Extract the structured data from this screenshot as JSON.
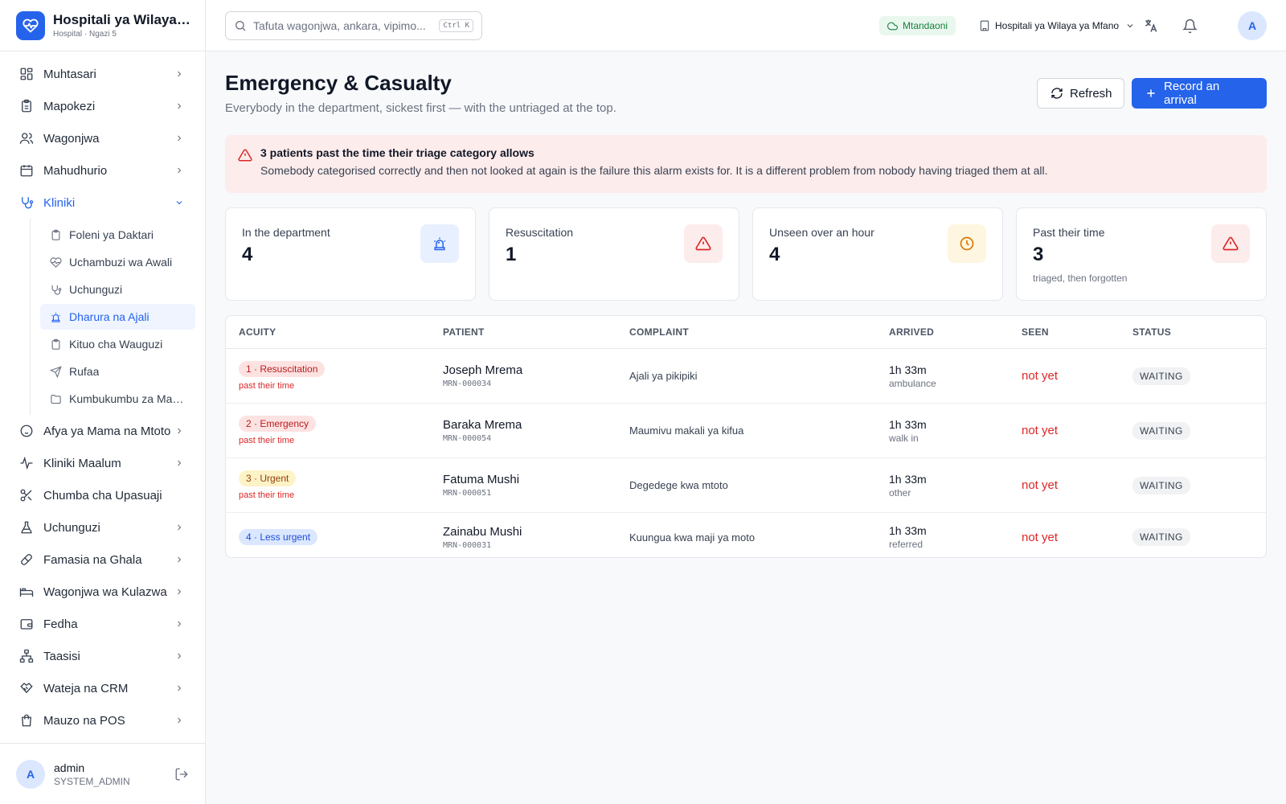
{
  "brand": {
    "name": "Hospitali ya Wilaya ya Mfano",
    "subtitle": "Hospital · Ngazi 5"
  },
  "sidebar": {
    "items": [
      {
        "label": "Muhtasari",
        "icon": "dashboard-icon"
      },
      {
        "label": "Mapokezi",
        "icon": "clipboard-icon"
      },
      {
        "label": "Wagonjwa",
        "icon": "users-icon"
      },
      {
        "label": "Mahudhurio",
        "icon": "calendar-icon"
      },
      {
        "label": "Kliniki",
        "icon": "stethoscope-icon"
      },
      {
        "label": "Afya ya Mama na Mtoto",
        "icon": "baby-icon"
      },
      {
        "label": "Kliniki Maalum",
        "icon": "pulse-icon"
      },
      {
        "label": "Chumba cha Upasuaji",
        "icon": "scissors-icon"
      },
      {
        "label": "Uchunguzi",
        "icon": "flask-icon"
      },
      {
        "label": "Famasia na Ghala",
        "icon": "pill-icon"
      },
      {
        "label": "Wagonjwa wa Kulazwa",
        "icon": "bed-icon"
      },
      {
        "label": "Fedha",
        "icon": "wallet-icon"
      },
      {
        "label": "Taasisi",
        "icon": "org-icon"
      },
      {
        "label": "Wateja na CRM",
        "icon": "handshake-icon"
      },
      {
        "label": "Mauzo na POS",
        "icon": "shopping-bag-icon"
      }
    ],
    "sub_items": [
      {
        "label": "Foleni ya Daktari",
        "icon": "clipboard-icon"
      },
      {
        "label": "Uchambuzi wa Awali",
        "icon": "heart-pulse-icon"
      },
      {
        "label": "Uchunguzi",
        "icon": "stethoscope-icon"
      },
      {
        "label": "Dharura na Ajali",
        "icon": "siren-icon"
      },
      {
        "label": "Kituo cha Wauguzi",
        "icon": "clipboard-icon"
      },
      {
        "label": "Rufaa",
        "icon": "send-icon"
      },
      {
        "label": "Kumbukumbu za Matibabu",
        "icon": "folder-icon"
      }
    ]
  },
  "user": {
    "initial": "A",
    "name": "admin",
    "role": "SYSTEM_ADMIN"
  },
  "topbar": {
    "search_placeholder": "Tafuta wagonjwa, ankara, vipimo...",
    "shortcut": "Ctrl K",
    "online": "Mtandaoni",
    "facility": "Hospitali ya Wilaya ya Mfano",
    "avatar_initial": "A"
  },
  "page": {
    "title": "Emergency & Casualty",
    "subtitle": "Everybody in the department, sickest first — with the untriaged at the top.",
    "refresh_label": "Refresh",
    "record_label": "Record an arrival"
  },
  "alert": {
    "title": "3 patients past the time their triage category allows",
    "body": "Somebody categorised correctly and then not looked at again is the failure this alarm exists for. It is a different problem from nobody having triaged them at all."
  },
  "stats": [
    {
      "label": "In the department",
      "value": "4",
      "note": "",
      "icon": "siren-icon"
    },
    {
      "label": "Resuscitation",
      "value": "1",
      "note": "",
      "icon": "warning-icon"
    },
    {
      "label": "Unseen over an hour",
      "value": "4",
      "note": "",
      "icon": "clock-icon"
    },
    {
      "label": "Past their time",
      "value": "3",
      "note": "triaged, then forgotten",
      "icon": "warning-icon"
    }
  ],
  "table": {
    "headers": [
      "ACUITY",
      "PATIENT",
      "COMPLAINT",
      "ARRIVED",
      "SEEN",
      "STATUS"
    ],
    "rows": [
      {
        "acuity": "1 · Resuscitation",
        "late": "past their time",
        "name": "Joseph Mrema",
        "mrn": "MRN-000034",
        "complaint": "Ajali ya pikipiki",
        "arrived": "1h 33m",
        "mode": "ambulance",
        "seen": "not yet",
        "status": "WAITING"
      },
      {
        "acuity": "2 · Emergency",
        "late": "past their time",
        "name": "Baraka Mrema",
        "mrn": "MRN-000054",
        "complaint": "Maumivu makali ya kifua",
        "arrived": "1h 33m",
        "mode": "walk in",
        "seen": "not yet",
        "status": "WAITING"
      },
      {
        "acuity": "3 · Urgent",
        "late": "past their time",
        "name": "Fatuma Mushi",
        "mrn": "MRN-000051",
        "complaint": "Degedege kwa mtoto",
        "arrived": "1h 33m",
        "mode": "other",
        "seen": "not yet",
        "status": "WAITING"
      },
      {
        "acuity": "4 · Less urgent",
        "late": "",
        "name": "Zainabu Mushi",
        "mrn": "MRN-000031",
        "complaint": "Kuungua kwa maji ya moto",
        "arrived": "1h 33m",
        "mode": "referred",
        "seen": "not yet",
        "status": "WAITING"
      }
    ]
  },
  "colors": {
    "accent": "#2563eb",
    "danger": "#dc2626",
    "acuity_1_bg": "#fde2e2",
    "acuity_1_fg": "#b91c1c",
    "acuity_2_bg": "#fde2e2",
    "acuity_2_fg": "#b91c1c",
    "acuity_3_bg": "#fef3c7",
    "acuity_3_fg": "#92400e",
    "acuity_4_bg": "#dbe7ff",
    "acuity_4_fg": "#1d4ed8"
  }
}
